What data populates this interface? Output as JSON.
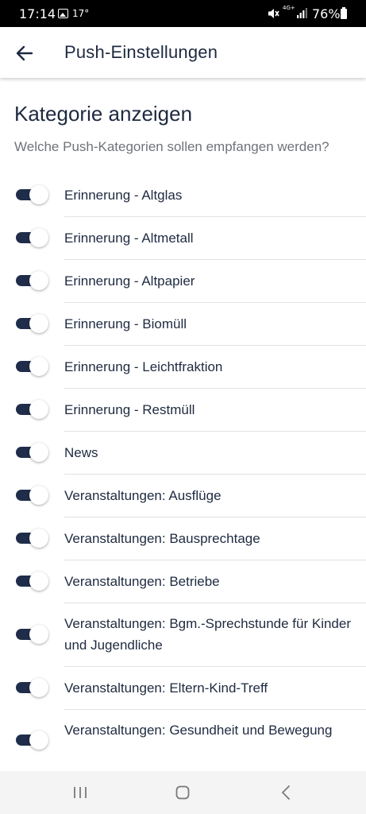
{
  "status_bar": {
    "time": "17:14",
    "temperature": "17°",
    "network": "4G+",
    "battery": "76%",
    "icons": [
      "image-icon",
      "mute-icon",
      "signal-icon",
      "battery-icon"
    ]
  },
  "app_bar": {
    "title": "Push-Einstellungen",
    "back_icon": "arrow-left-icon"
  },
  "main": {
    "section_title": "Kategorie anzeigen",
    "section_subtitle": "Welche Push-Kategorien sollen empfangen werden?",
    "items": [
      {
        "label": "Erinnerung - Altglas",
        "enabled": true
      },
      {
        "label": "Erinnerung - Altmetall",
        "enabled": true
      },
      {
        "label": "Erinnerung - Altpapier",
        "enabled": true
      },
      {
        "label": "Erinnerung - Biomüll",
        "enabled": true
      },
      {
        "label": "Erinnerung - Leichtfraktion",
        "enabled": true
      },
      {
        "label": "Erinnerung - Restmüll",
        "enabled": true
      },
      {
        "label": "News",
        "enabled": true
      },
      {
        "label": "Veranstaltungen: Ausflüge",
        "enabled": true
      },
      {
        "label": "Veranstaltungen: Bausprechtage",
        "enabled": true
      },
      {
        "label": "Veranstaltungen: Betriebe",
        "enabled": true
      },
      {
        "label": "Veranstaltungen: Bgm.-Sprechstunde für Kinder und Jugendliche",
        "enabled": true
      },
      {
        "label": "Veranstaltungen: Eltern-Kind-Treff",
        "enabled": true
      },
      {
        "label": "Veranstaltungen: Gesundheit und Bewegung",
        "enabled": true
      }
    ]
  },
  "nav_bar": {
    "buttons": [
      "recent-apps-icon",
      "home-icon",
      "back-icon"
    ]
  },
  "colors": {
    "primary": "#1f2d4a",
    "text": "#1e2a40",
    "subtitle": "#6f737a",
    "divider": "#e2e2e2"
  }
}
